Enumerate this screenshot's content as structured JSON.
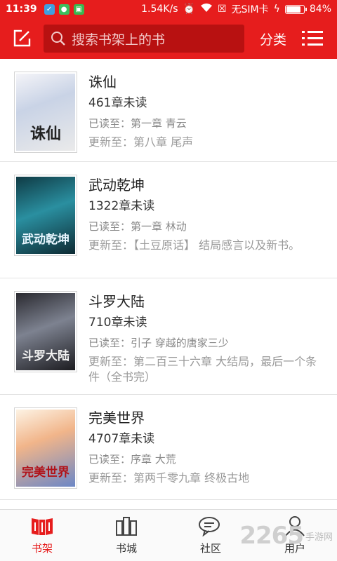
{
  "status_bar": {
    "time": "11:39",
    "speed": "1.54K/s",
    "sim": "无SIM卡",
    "battery": "84%",
    "battery_level": 0.84
  },
  "header": {
    "edit_icon": "edit-icon",
    "search_placeholder": "搜索书架上的书",
    "category_label": "分类",
    "menu_icon": "list-menu-icon",
    "accent_color": "#e61d1d"
  },
  "books": [
    {
      "title": "诛仙",
      "unread": "461章未读",
      "read_to": "已读至：第一章 青云",
      "updated_to": "更新至：第八章 尾声",
      "cover_text": "诛仙"
    },
    {
      "title": "武动乾坤",
      "unread": "1322章未读",
      "read_to": "已读至：第一章 林动",
      "updated_to": "更新至：【土豆原话】 结局感言以及新书。",
      "cover_text": "武动乾坤"
    },
    {
      "title": "斗罗大陆",
      "unread": "710章未读",
      "read_to": "已读至：引子 穿越的唐家三少",
      "updated_to": "更新至：第二百三十六章 大结局，最后一个条件（全书完）",
      "cover_text": "斗罗大陆"
    },
    {
      "title": "完美世界",
      "unread": "4707章未读",
      "read_to": "已读至：序章 大荒",
      "updated_to": "更新至：第两千零九章 终极古地",
      "cover_text": "完美世界"
    }
  ],
  "bottom_nav": [
    {
      "label": "书架",
      "icon": "bookshelf-icon",
      "active": true
    },
    {
      "label": "书城",
      "icon": "bookstore-icon",
      "active": false
    },
    {
      "label": "社区",
      "icon": "community-icon",
      "active": false
    },
    {
      "label": "用户",
      "icon": "user-icon",
      "active": false
    }
  ],
  "watermark": {
    "big": "2265",
    "small": "手游网"
  }
}
